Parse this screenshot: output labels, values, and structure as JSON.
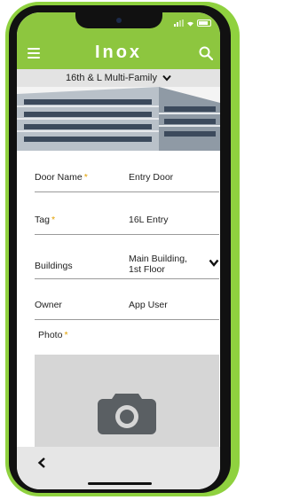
{
  "header": {
    "logo_text": "Inox",
    "bg_color": "#8dc63f"
  },
  "property": {
    "name": "16th & L Multi-Family"
  },
  "form": {
    "door_name": {
      "label": "Door Name",
      "required": "*",
      "value": "Entry Door"
    },
    "tag": {
      "label": "Tag",
      "required": "*",
      "value": "16L Entry"
    },
    "buildings": {
      "label": "Buildings",
      "value_line1": "Main Building,",
      "value_line2": "1st Floor"
    },
    "owner": {
      "label": "Owner",
      "value": "App User"
    },
    "photo": {
      "label": "Photo",
      "required": "*"
    }
  },
  "icons": [
    "menu-icon",
    "search-icon",
    "chevron-down-icon",
    "camera-icon",
    "back-icon"
  ],
  "colors": {
    "accent": "#8dc63f",
    "required": "#e3a000",
    "photo_bg": "#d6d6d6"
  }
}
